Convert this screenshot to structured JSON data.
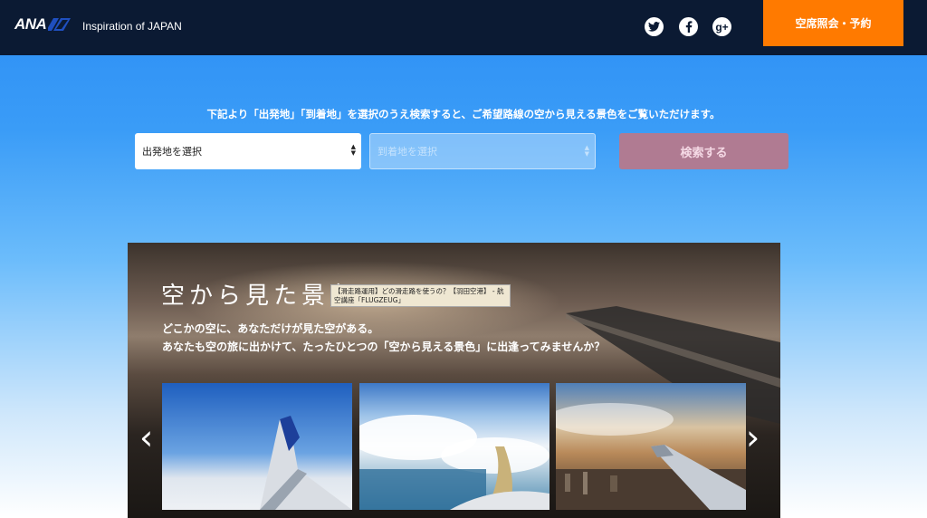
{
  "header": {
    "logo_text": "ANA",
    "tagline": "Inspiration of JAPAN",
    "reserve_label": "空席照会・予約",
    "social": [
      {
        "icon": "twitter-icon",
        "glyph": "t"
      },
      {
        "icon": "facebook-icon",
        "glyph": "f"
      },
      {
        "icon": "google-plus-icon",
        "glyph": "g+"
      }
    ]
  },
  "search": {
    "intro": "下記より「出発地」「到着地」を選択のうえ検索すると、ご希望路線の空から見える景色をご覧いただけます。",
    "origin_placeholder": "出発地を選択",
    "destination_placeholder": "到着地を選択",
    "button_label": "検索する"
  },
  "hero": {
    "title": "空から見た景色",
    "line1": "どこかの空に、あなただけが見た空がある。",
    "line2": "あなたも空の旅に出かけて、たったひとつの「空から見える景色」に出逢ってみませんか？",
    "tooltip": "【滑走路運用】どの滑走路を使うの？【羽田空港】 - 航空講座「FLUGZEUG」",
    "prev_arrow": "‹",
    "next_arrow": "›"
  },
  "colors": {
    "header_bg": "#0b1a33",
    "reserve_bg": "#ff7a00",
    "search_button_bg": "#b07b92",
    "ana_blue": "#1f4fbf"
  }
}
